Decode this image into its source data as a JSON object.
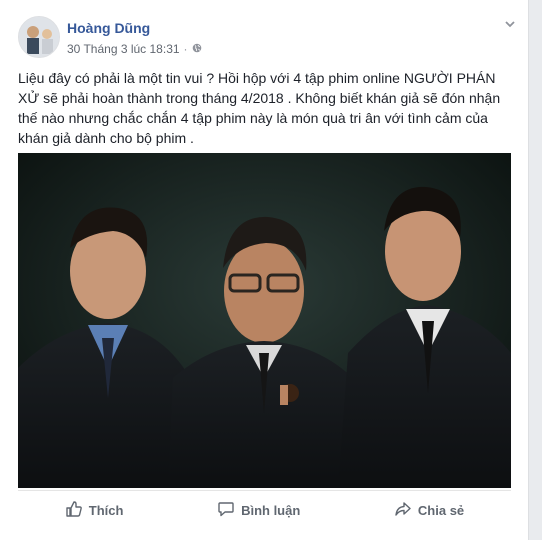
{
  "post": {
    "author": "Hoàng Dũng",
    "timestamp": "30 Tháng 3 lúc 18:31",
    "separator": "·",
    "privacy_icon": "globe-icon",
    "text": "Liệu đây có phải là một tin vui ? Hồi hộp với 4 tập phim online NGƯỜI PHÁN XỬ sẽ phải hoàn thành trong tháng 4/2018 . Không biết khán giả sẽ đón nhận thế nào nhưng chắc chắn 4 tập phim này là món quà tri ân với tình cảm của khán giả dành cho bộ phim ."
  },
  "actions": {
    "like": "Thích",
    "comment": "Bình luận",
    "share": "Chia sẻ"
  },
  "colors": {
    "author": "#365899",
    "meta": "#616770",
    "text": "#1d2129",
    "action": "#606770"
  }
}
